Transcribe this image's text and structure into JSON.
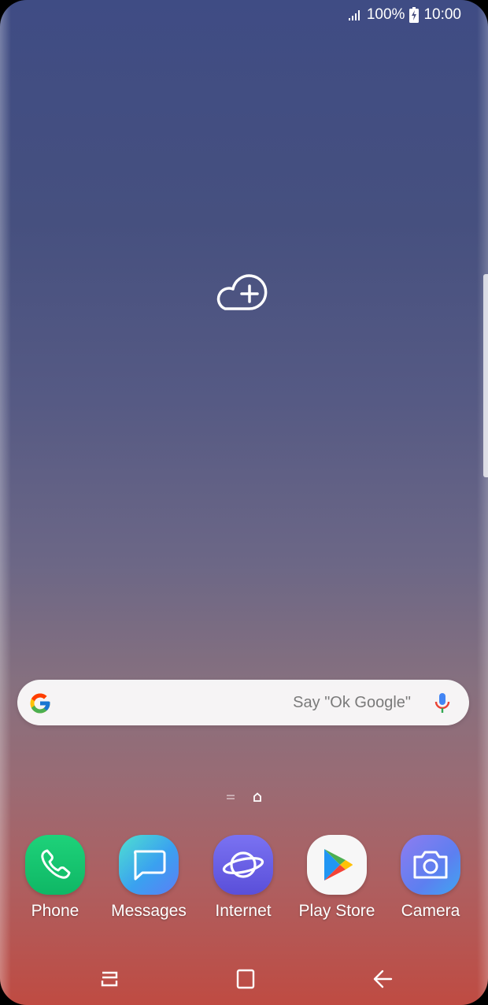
{
  "status_bar": {
    "battery_percent": "100%",
    "time": "10:00",
    "icons": [
      "signal-icon",
      "battery-charging-icon"
    ]
  },
  "wallpaper": {
    "colors": {
      "top": "#3f4c84",
      "bottom": "#bf4b42"
    }
  },
  "widget": {
    "icon": "cloud-add-icon"
  },
  "search": {
    "placeholder": "Say \"Ok Google\"",
    "icons": [
      "google-g-icon",
      "microphone-icon"
    ]
  },
  "page_indicator": {
    "icons": [
      "pages-icon",
      "home-page-icon"
    ]
  },
  "dock": {
    "apps": [
      {
        "label": "Phone",
        "icon": "phone-icon"
      },
      {
        "label": "Messages",
        "icon": "messages-icon"
      },
      {
        "label": "Internet",
        "icon": "internet-icon"
      },
      {
        "label": "Play Store",
        "icon": "play-store-icon"
      },
      {
        "label": "Camera",
        "icon": "camera-icon"
      }
    ]
  },
  "nav_bar": {
    "buttons": [
      "recent-apps-icon",
      "home-icon",
      "back-icon"
    ]
  }
}
